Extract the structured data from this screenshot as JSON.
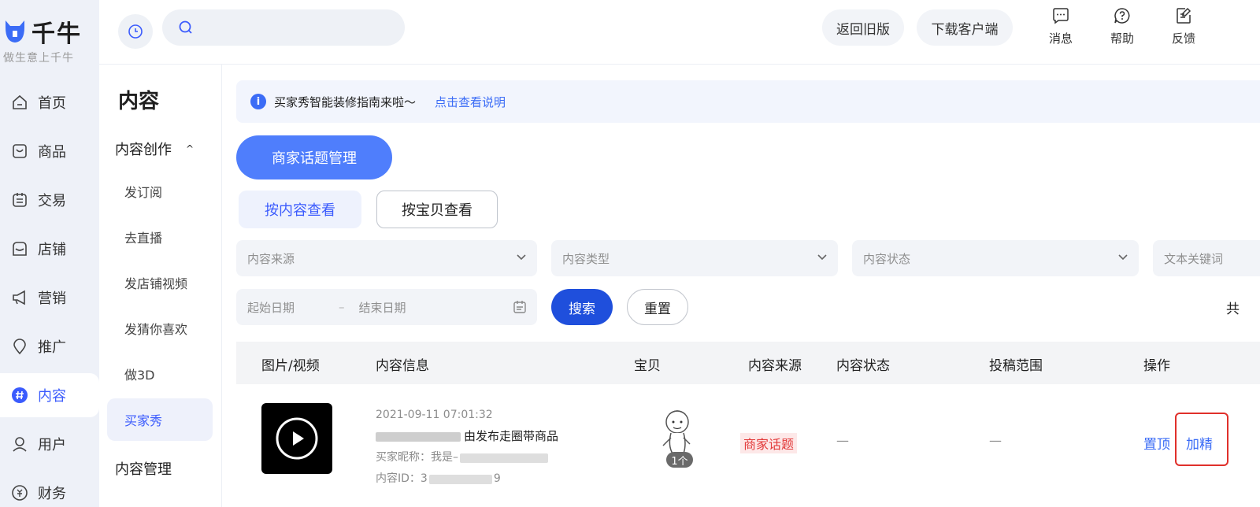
{
  "brand": {
    "name": "千牛",
    "slogan": "做生意上千牛"
  },
  "rail": {
    "items": [
      {
        "label": "首页",
        "icon": "home-icon"
      },
      {
        "label": "商品",
        "icon": "goods-icon"
      },
      {
        "label": "交易",
        "icon": "trade-icon"
      },
      {
        "label": "店铺",
        "icon": "store-icon"
      },
      {
        "label": "营销",
        "icon": "megaphone-icon"
      },
      {
        "label": "推广",
        "icon": "location-icon"
      },
      {
        "label": "内容",
        "icon": "hashtag-icon"
      },
      {
        "label": "用户",
        "icon": "user-icon"
      },
      {
        "label": "财务",
        "icon": "finance-icon"
      }
    ],
    "active": "内容"
  },
  "topbar": {
    "search_placeholder": "",
    "back_old_version": "返回旧版",
    "download_client": "下载客户端",
    "messages": "消息",
    "help": "帮助",
    "feedback": "反馈"
  },
  "subnav": {
    "title": "内容",
    "group1": "内容创作",
    "items": [
      "发订阅",
      "去直播",
      "发店铺视频",
      "发猜你喜欢",
      "做3D",
      "买家秀"
    ],
    "active": "买家秀",
    "group2": "内容管理"
  },
  "notice": {
    "text": "买家秀智能装修指南来啦～",
    "link": "点击查看说明"
  },
  "actions": {
    "topic_manage": "商家话题管理"
  },
  "view_tabs": {
    "by_content": "按内容查看",
    "by_item": "按宝贝查看"
  },
  "filters": {
    "source": "内容来源",
    "type": "内容类型",
    "status": "内容状态",
    "keyword": "文本关键词",
    "start_date": "起始日期",
    "date_sep": "–",
    "end_date": "结束日期",
    "search": "搜索",
    "reset": "重置",
    "count_fragment": "共"
  },
  "table": {
    "headers": [
      "图片/视频",
      "内容信息",
      "宝贝",
      "内容来源",
      "内容状态",
      "投稿范围",
      "操作"
    ],
    "rows": [
      {
        "datetime": "2021-09-11 07:01:32",
        "title_suffix": "由发布走圈带商品",
        "buyer_label": "买家昵称：",
        "buyer_value": "我是–",
        "id_label": "内容ID：",
        "id_prefix": "3",
        "id_suffix": "9",
        "product_count": "1个",
        "source": "商家话题",
        "status": "—",
        "scope": "—",
        "op_pin": "置顶",
        "op_feature": "加精"
      }
    ]
  },
  "colors": {
    "accent": "#3b5bfd",
    "primary_button": "#4f7efc",
    "search_button": "#1f4fdc",
    "source_tag": "#e23b3b",
    "highlight": "#e0302b"
  }
}
